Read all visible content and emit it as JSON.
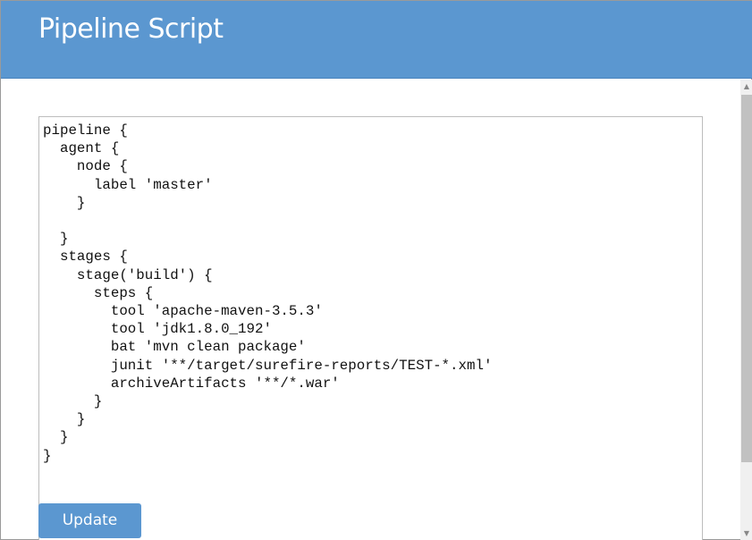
{
  "header": {
    "title": "Pipeline Script"
  },
  "editor": {
    "code": "pipeline {\n  agent {\n    node {\n      label 'master'\n    }\n\n  }\n  stages {\n    stage('build') {\n      steps {\n        tool 'apache-maven-3.5.3'\n        tool 'jdk1.8.0_192'\n        bat 'mvn clean package'\n        junit '**/target/surefire-reports/TEST-*.xml'\n        archiveArtifacts '**/*.war'\n      }\n    }\n  }\n}"
  },
  "actions": {
    "update_label": "Update"
  },
  "colors": {
    "accent": "#5b97d0"
  }
}
